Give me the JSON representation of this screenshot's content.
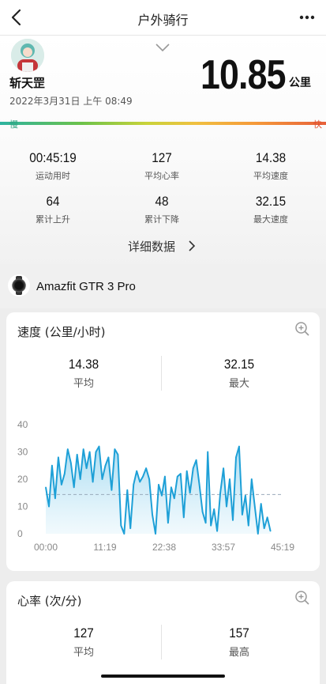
{
  "nav": {
    "title": "户外骑行",
    "back_icon": "chevron-left-icon",
    "more_icon": "more-dots-icon"
  },
  "summary": {
    "username": "斩天罡",
    "datetime": "2022年3月31日 上午 08:49",
    "distance": "10.85",
    "distance_unit": "公里",
    "pace_slow": "慢",
    "pace_fast": "快",
    "stats": [
      {
        "value": "00:45:19",
        "label": "运动用时"
      },
      {
        "value": "127",
        "label": "平均心率"
      },
      {
        "value": "14.38",
        "label": "平均速度"
      },
      {
        "value": "64",
        "label": "累计上升"
      },
      {
        "value": "48",
        "label": "累计下降"
      },
      {
        "value": "32.15",
        "label": "最大速度"
      }
    ],
    "details_label": "详细数据"
  },
  "device": {
    "name": "Amazfit GTR 3 Pro",
    "icon": "watch-icon"
  },
  "speed_card": {
    "title": "速度 (公里/小时)",
    "avg_value": "14.38",
    "avg_label": "平均",
    "max_value": "32.15",
    "max_label": "最大"
  },
  "hr_card": {
    "title": "心率 (次/分)",
    "avg_value": "127",
    "avg_label": "平均",
    "max_value": "157",
    "max_label": "最高"
  },
  "colors": {
    "line": "#1ea0d7",
    "fill": "#bfe6f6",
    "pace_slow": "#2aa17d",
    "pace_fast": "#e0502e"
  },
  "chart_data": {
    "type": "area",
    "title": "速度 (公里/小时)",
    "xlabel": "",
    "ylabel": "",
    "x_ticks": [
      "00:00",
      "11:19",
      "22:38",
      "33:57",
      "45:19"
    ],
    "y_ticks": [
      "0",
      "10",
      "20",
      "30",
      "40"
    ],
    "ylim": [
      0,
      40
    ],
    "xlim_minutes": [
      0,
      45.32
    ],
    "reference_line": 14.38,
    "grid": false,
    "series": [
      {
        "x_minutes": [
          0,
          0.6,
          1.2,
          1.8,
          2.4,
          3,
          3.6,
          4.2,
          4.8,
          5.4,
          6,
          6.6,
          7.2,
          7.8,
          8.4,
          9,
          9.6,
          10.2,
          10.8,
          11.4,
          12,
          12.6,
          13.2,
          13.8,
          14.4,
          15,
          15.6,
          16.2,
          16.8,
          17.4,
          18,
          18.6,
          19.2,
          19.8,
          20.4,
          21,
          21.6,
          22.2,
          22.8,
          23.4,
          24,
          24.6,
          25.2,
          25.8,
          26.4,
          27,
          27.6,
          28.2,
          28.8,
          29.4,
          30,
          30.6,
          31,
          31.6,
          32.2,
          32.8,
          33.4,
          34,
          34.6,
          35.2,
          35.8,
          36.4,
          37,
          37.6,
          38.2,
          38.8,
          39.4,
          40,
          40.6,
          41.2,
          41.8,
          42.4,
          43
        ],
        "values": [
          17,
          10,
          25,
          13,
          28,
          18,
          22,
          31,
          26,
          17,
          29,
          20,
          31,
          24,
          30,
          19,
          30,
          32,
          20,
          25,
          28,
          16,
          31,
          29,
          3,
          0,
          16,
          2,
          18,
          23,
          19,
          21,
          24,
          20,
          7,
          0,
          18,
          14,
          21,
          4,
          17,
          13,
          21,
          22,
          6,
          23,
          15,
          24,
          27,
          18,
          8,
          4,
          30,
          3,
          9,
          1,
          15,
          24,
          10,
          20,
          5,
          28,
          32,
          7,
          14,
          3,
          20,
          10,
          0,
          11,
          2,
          6,
          1
        ]
      }
    ]
  }
}
